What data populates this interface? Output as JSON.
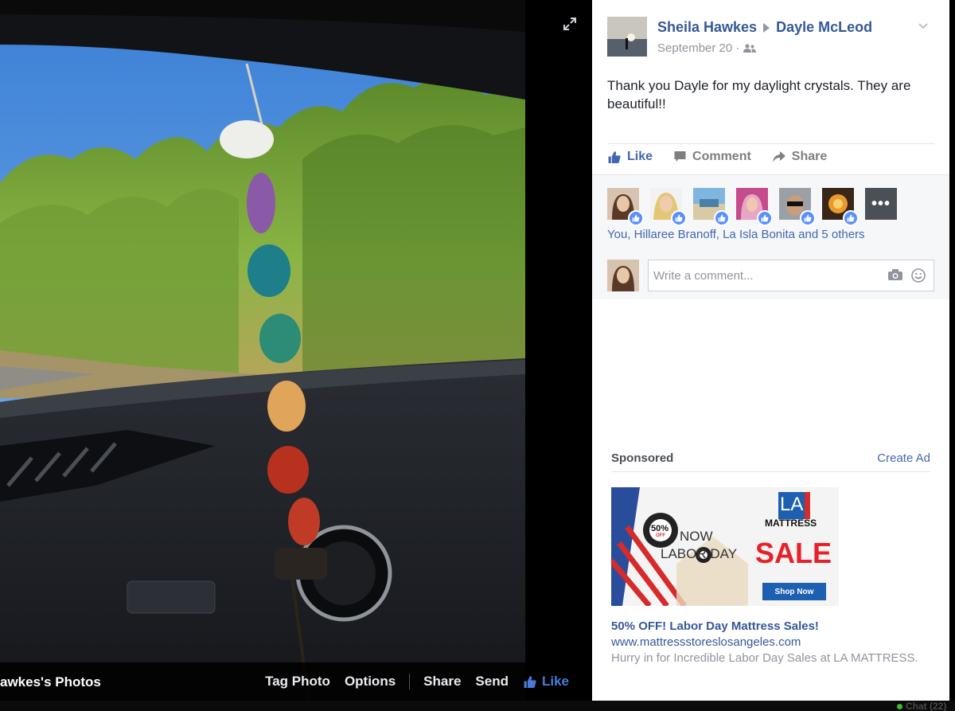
{
  "post": {
    "author": "Sheila Hawkes",
    "recipient": "Dayle McLeod",
    "date": "September 20 ·",
    "privacy_icon": "friends-icon",
    "text": "Thank you Dayle for my daylight crystals. They are beautiful!!"
  },
  "actions": {
    "like": "Like",
    "comment": "Comment",
    "share": "Share"
  },
  "likes": {
    "summary": "You, Hillaree Branoff, La Isla Bonita and 5 others",
    "more_label": "•••"
  },
  "comment_box": {
    "placeholder": "Write a comment..."
  },
  "sponsored": {
    "label": "Sponsored",
    "create_ad": "Create Ad",
    "ad_title": "50% OFF! Labor Day Mattress Sales!",
    "ad_url": "www.mattressstoreslosangeles.com",
    "ad_description": "Hurry in for Incredible Labor Day Sales at LA MATTRESS.",
    "banner": {
      "logo_top": "LA",
      "logo_bottom": "MATTRESS",
      "percent": "50%",
      "off": "OFF",
      "now": "NOW",
      "holiday": "LABOR DAY",
      "sale": "SALE",
      "cta": "Shop Now"
    }
  },
  "photo_bar": {
    "album_title": "awkes's Photos",
    "tag_photo": "Tag Photo",
    "options": "Options",
    "share": "Share",
    "send": "Send",
    "like": "Like"
  },
  "chat": {
    "label": "Chat (22)"
  },
  "colors": {
    "brand_blue": "#4267b2",
    "link_blue": "#365899",
    "like_badge": "#5890ff",
    "sale_red": "#e8202a"
  }
}
